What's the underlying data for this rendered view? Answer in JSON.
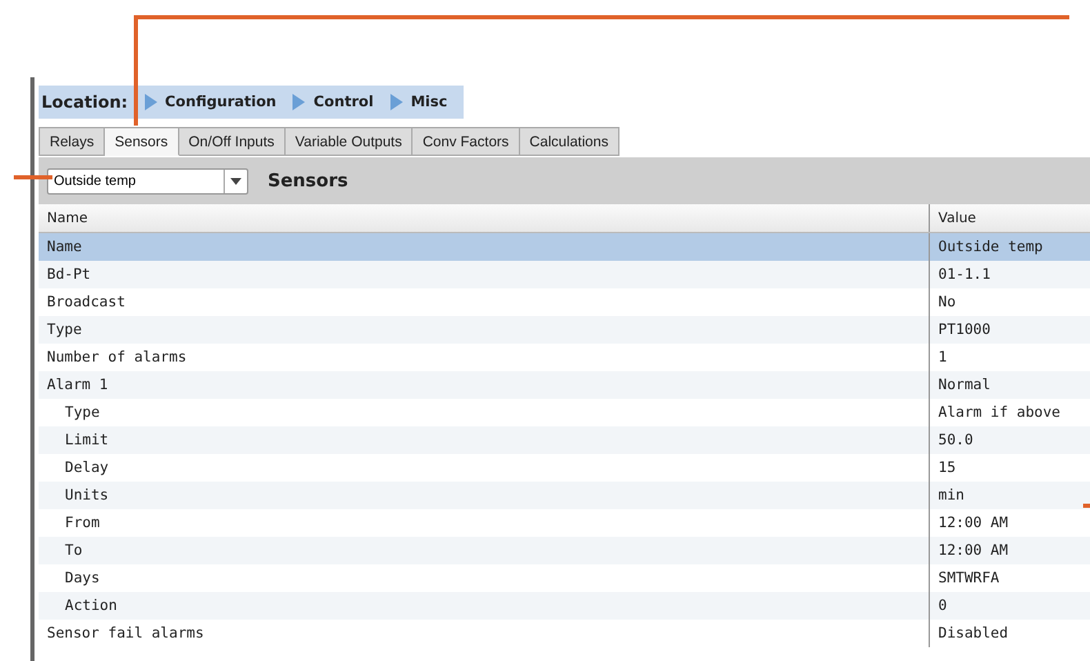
{
  "location": {
    "label": "Location:",
    "crumbs": [
      "Configuration",
      "Control",
      "Misc"
    ]
  },
  "tabs": [
    {
      "label": "Relays",
      "selected": false
    },
    {
      "label": "Sensors",
      "selected": true
    },
    {
      "label": "On/Off Inputs",
      "selected": false
    },
    {
      "label": "Variable Outputs",
      "selected": false
    },
    {
      "label": "Conv Factors",
      "selected": false
    },
    {
      "label": "Calculations",
      "selected": false
    }
  ],
  "toolbar": {
    "dropdown_value": "Outside temp",
    "title": "Sensors"
  },
  "table": {
    "columns": [
      "Name",
      "Value"
    ],
    "rows": [
      {
        "name": "Name",
        "value": "Outside temp",
        "selected": true,
        "children": []
      },
      {
        "name": "Bd-Pt",
        "value": "01-1.1",
        "selected": false,
        "children": []
      },
      {
        "name": "Broadcast",
        "value": "No",
        "selected": false,
        "children": []
      },
      {
        "name": "Type",
        "value": "PT1000",
        "selected": false,
        "children": []
      },
      {
        "name": "Number of alarms",
        "value": "1",
        "selected": false,
        "children": []
      },
      {
        "name": "Alarm 1",
        "value": "Normal",
        "selected": false,
        "children": [
          {
            "name": "Type",
            "value": "Alarm if above",
            "selected": false
          },
          {
            "name": "Limit",
            "value": "50.0",
            "selected": false
          },
          {
            "name": "Delay",
            "value": "15",
            "selected": false
          },
          {
            "name": "Units",
            "value": "min",
            "selected": false
          },
          {
            "name": "From",
            "value": "12:00 AM",
            "selected": false
          },
          {
            "name": "To",
            "value": "12:00 AM",
            "selected": false
          },
          {
            "name": "Days",
            "value": "SMTWRFA",
            "selected": false
          },
          {
            "name": "Action",
            "value": "0",
            "selected": false
          }
        ]
      },
      {
        "name": "Sensor fail alarms",
        "value": "Disabled",
        "selected": false,
        "children": []
      }
    ]
  }
}
